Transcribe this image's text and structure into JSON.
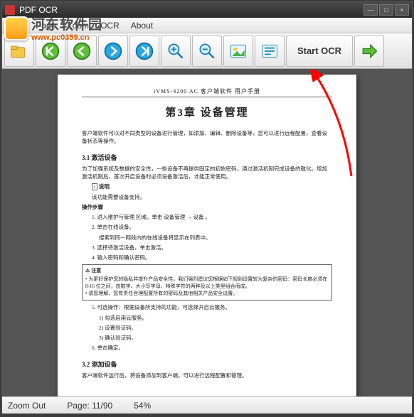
{
  "title": "PDF OCR",
  "menu": {
    "file": "File",
    "page": "Page",
    "zoom": "Zoom",
    "ocr": "OCR",
    "about": "About"
  },
  "toolbar": {
    "start_ocr": "Start OCR"
  },
  "watermark": {
    "site_cn": "河东软件园",
    "site_url": "www.pc0359.cn"
  },
  "doc": {
    "header": "iVMS-4200 AC 客户端软件 用户手册",
    "chapter": "第3章 设备管理",
    "intro": "客户端软件可以对不同类型的设备进行管理，如添加、编辑、删除设备等，您可以进行远程配置，查看设备状态等操作。",
    "s31_title": "3.1 激活设备",
    "s31_body": "为了加强系统及数据的安全性，一些设备不再提供固定的初始密码，通过激活机制完成设备的敬化。增加激活机制后，首次开启设备时必须设备激活后，才能正常使用。",
    "s31_note_title": "说明",
    "s31_note": "该功能需要设备支持。",
    "s31_steps_title": "操作步骤",
    "s31_step1": "1. 进入维护与管理 区域。单击 设备管理 → 设备 。",
    "s31_step2": "2. 单击在线设备。",
    "s31_step3": "搜索到同一网段内的在线设备将显示在列表中。",
    "s31_step4": "3. 选择待激活设备，单击激活。",
    "s31_step5": "4. 输入密码和确认密码。",
    "s31_warn_title": "注意",
    "s31_warn1": "• 为更好保护您的隐私并提升产品安全性，我们强烈建议您根据如下规则设置较为复杂的密码：密码长度必须在 8-16 位之间，由数字、大小写字母、特殊字符的两种及以上类型组合而成。",
    "s31_warn2": "• 请您理解，您有责任合理配置所有的密码及其他相关产品安全设置。",
    "s31_step6": "5. 可选操作：根据设备所支持的功能，可选择开启云服务。",
    "s31_sub1": "1) 勾选启用云服务。",
    "s31_sub2": "2) 设置验证码。",
    "s31_sub3": "3) 确认验证码。",
    "s31_step7": "6. 单击确定。",
    "s32_title": "3.2 添加设备",
    "s32_body": "客户端软件运行后，将设备添加到客户端，可以进行远程配置和管理。"
  },
  "status": {
    "state": "Zoom Out",
    "page_label": "Page:",
    "page": "11/90",
    "zoom": "54%"
  }
}
